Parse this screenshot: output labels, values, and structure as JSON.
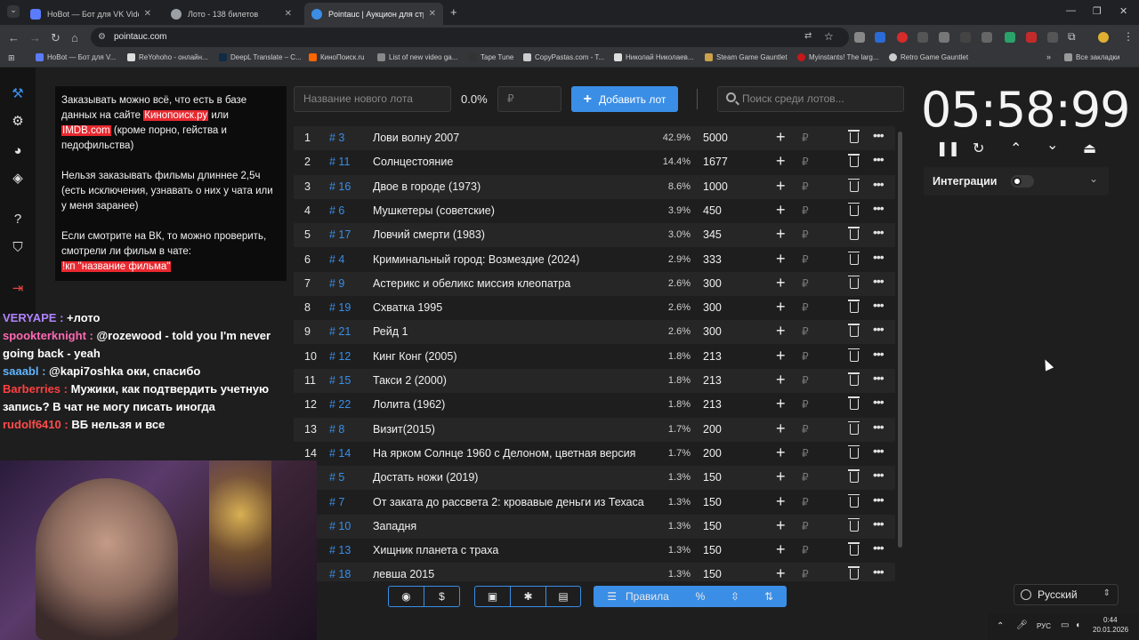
{
  "browser": {
    "tabs": [
      {
        "title": "HoBot — Бот для VK Video Live",
        "color": "#5b7cff"
      },
      {
        "title": "Лото - 138 билетов",
        "color": "#9aa0a6"
      },
      {
        "title": "Pointauc | Аукцион для стрима",
        "color": "#3a8ee6"
      }
    ],
    "url": "pointauc.com",
    "bookmarks": [
      {
        "label": "HoBot — Бот для V...",
        "color": "#5b7cff"
      },
      {
        "label": "ReYohoho - онлайн...",
        "color": "#dddddd"
      },
      {
        "label": "DeepL Translate – С...",
        "color": "#0f2b46"
      },
      {
        "label": "КиноПоиск.ru",
        "color": "#ff6600"
      },
      {
        "label": "List of new video ga...",
        "color": "#888888"
      },
      {
        "label": "Tape Tune",
        "color": "#333333"
      },
      {
        "label": "CopyPastas.com - T...",
        "color": "#cccccc"
      },
      {
        "label": "Николай Николаев...",
        "color": "#dddddd"
      },
      {
        "label": "Steam Game Gauntlet",
        "color": "#c9a24a"
      },
      {
        "label": "Myinstants! The larg...",
        "color": "#c81818"
      },
      {
        "label": "Retro Game Gauntlet",
        "color": "#cccccc"
      },
      {
        "label": "Все закладки",
        "color": "#cccccc"
      }
    ]
  },
  "rules": {
    "p1_pre": "Заказывать можно всё, что есть в базе данных на сайте ",
    "p1_link1": "Кинопоиск.ру",
    "p1_mid": " или ",
    "p1_link2": "IMDB.com",
    "p1_post": " (кроме порно, гейства и педофильства)",
    "p2": "Нельзя заказывать фильмы длиннее 2,5ч (есть исключения, узнавать о них у чата или у меня заранее)",
    "p3": "Если смотрите на ВК, то можно проверить, смотрели ли фильм в чате:",
    "p3_cmd": "!кп \"название фильма\""
  },
  "toolbar": {
    "lot_name_placeholder": "Название нового лота",
    "total_percent": "0.0%",
    "amount_placeholder": "₽",
    "add_label": "Добавить лот",
    "search_placeholder": "Поиск среди лотов..."
  },
  "lots": [
    {
      "num": "1",
      "id": "# 3",
      "name": "Лови волну 2007",
      "pct": "42.9%",
      "amount": "5000"
    },
    {
      "num": "2",
      "id": "# 11",
      "name": "Солнцестояние",
      "pct": "14.4%",
      "amount": "1677"
    },
    {
      "num": "3",
      "id": "# 16",
      "name": "Двое в городе (1973)",
      "pct": "8.6%",
      "amount": "1000"
    },
    {
      "num": "4",
      "id": "# 6",
      "name": "Мушкетеры (советские)",
      "pct": "3.9%",
      "amount": "450"
    },
    {
      "num": "5",
      "id": "# 17",
      "name": "Ловчий смерти (1983)",
      "pct": "3.0%",
      "amount": "345"
    },
    {
      "num": "6",
      "id": "# 4",
      "name": "Криминальный город: Возмездие (2024)",
      "pct": "2.9%",
      "amount": "333"
    },
    {
      "num": "7",
      "id": "# 9",
      "name": "Астерикс и обеликс миссия клеопатра",
      "pct": "2.6%",
      "amount": "300"
    },
    {
      "num": "8",
      "id": "# 19",
      "name": "Схватка 1995",
      "pct": "2.6%",
      "amount": "300"
    },
    {
      "num": "9",
      "id": "# 21",
      "name": "Рейд 1",
      "pct": "2.6%",
      "amount": "300"
    },
    {
      "num": "10",
      "id": "# 12",
      "name": "Кинг Конг (2005)",
      "pct": "1.8%",
      "amount": "213"
    },
    {
      "num": "11",
      "id": "# 15",
      "name": "Такси 2 (2000)",
      "pct": "1.8%",
      "amount": "213"
    },
    {
      "num": "12",
      "id": "# 22",
      "name": "Лолита (1962)",
      "pct": "1.8%",
      "amount": "213"
    },
    {
      "num": "13",
      "id": "# 8",
      "name": "Визит(2015)",
      "pct": "1.7%",
      "amount": "200"
    },
    {
      "num": "14",
      "id": "# 14",
      "name": "На ярком Солнце 1960 с Делоном, цветная версия",
      "pct": "1.7%",
      "amount": "200"
    },
    {
      "num": "",
      "id": "# 5",
      "name": "Достать ножи (2019)",
      "pct": "1.3%",
      "amount": "150"
    },
    {
      "num": "",
      "id": "# 7",
      "name": "От заката до рассвета 2: кровавые деньги из Техаса",
      "pct": "1.3%",
      "amount": "150"
    },
    {
      "num": "",
      "id": "# 10",
      "name": "Западня",
      "pct": "1.3%",
      "amount": "150"
    },
    {
      "num": "",
      "id": "# 13",
      "name": "Хищник планета с траха",
      "pct": "1.3%",
      "amount": "150"
    },
    {
      "num": "",
      "id": "# 18",
      "name": "левша 2015",
      "pct": "1.3%",
      "amount": "150"
    }
  ],
  "bottom": {
    "rules_label": "Правила",
    "percent_symbol": "%"
  },
  "timer": {
    "value": "05:58:99",
    "integrations_label": "Интеграции"
  },
  "language": "Русский",
  "chat": [
    {
      "user": "VERYAPE",
      "color": "#b084ff",
      "text": " +лото"
    },
    {
      "user": "spookterknight",
      "color": "#ff69b4",
      "text": " @rozewood - told you I'm never going back - yeah"
    },
    {
      "user": "saaabl",
      "color": "#5fb4ff",
      "text": " @kapi7oshka оки, спасибо"
    },
    {
      "user": "Barberries",
      "color": "#ff4040",
      "text": " Мужики, как подтвердить учетную запись? В чат не могу писать иногда"
    },
    {
      "user": "rudolf6410",
      "color": "#ff4b4b",
      "text": " ВБ нельзя и все"
    }
  ],
  "tray": {
    "lang": "РУС",
    "time": "0:44",
    "date": "20.01.2026"
  }
}
